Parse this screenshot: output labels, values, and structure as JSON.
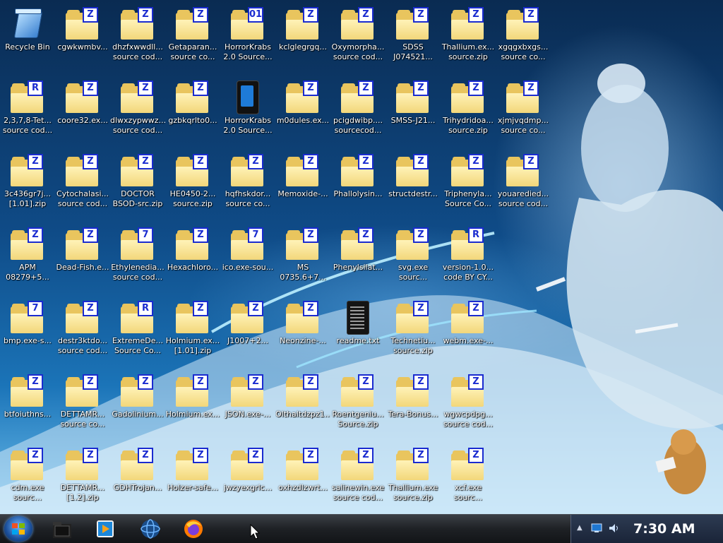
{
  "desktop": {
    "icons": [
      {
        "label": "Recycle Bin",
        "type": "recycle"
      },
      {
        "label": "cgwkwmbv...",
        "type": "zip",
        "badge": "Z"
      },
      {
        "label": "dhzfxwwdll... source cod...",
        "type": "zip",
        "badge": "Z"
      },
      {
        "label": "Getaparan... source co...",
        "type": "zip",
        "badge": "Z"
      },
      {
        "label": "HorrorKrabs 2.0 Source...",
        "type": "zip",
        "badge": "01"
      },
      {
        "label": "kclglegrgq...",
        "type": "zip",
        "badge": "Z"
      },
      {
        "label": "Oxymorpha... source cod...",
        "type": "zip",
        "badge": "Z"
      },
      {
        "label": "SDSS J074521...",
        "type": "zip",
        "badge": "Z"
      },
      {
        "label": "Thallium.ex... source.zip",
        "type": "zip",
        "badge": "Z"
      },
      {
        "label": "xgqgxbxgs... source co...",
        "type": "zip",
        "badge": "Z"
      },
      {
        "label": "2,3,7,8-Tet... source cod...",
        "type": "zip",
        "badge": "R"
      },
      {
        "label": "coore32.ex...",
        "type": "zip",
        "badge": "Z"
      },
      {
        "label": "dlwxzypwwz... source cod...",
        "type": "zip",
        "badge": "Z"
      },
      {
        "label": "gzbkqrlto0...",
        "type": "zip",
        "badge": "Z"
      },
      {
        "label": "HorrorKrabs 2.0 Source...",
        "type": "app"
      },
      {
        "label": "m0dules.ex...",
        "type": "zip",
        "badge": "Z"
      },
      {
        "label": "pcigdwibp.... sourcecod...",
        "type": "zip",
        "badge": "Z"
      },
      {
        "label": "SMSS-J21...",
        "type": "zip",
        "badge": "Z"
      },
      {
        "label": "Trihydridoa... source.zip",
        "type": "zip",
        "badge": "Z"
      },
      {
        "label": "xjmjvqdmp... source co...",
        "type": "zip",
        "badge": "Z"
      },
      {
        "label": "3c436gr7j... [1.01].zip",
        "type": "zip",
        "badge": "Z"
      },
      {
        "label": "Cytochalasi... source cod...",
        "type": "zip",
        "badge": "Z"
      },
      {
        "label": "DOCTOR BSOD-src.zip",
        "type": "zip",
        "badge": "Z"
      },
      {
        "label": "HE0450-2... source.zip",
        "type": "zip",
        "badge": "Z"
      },
      {
        "label": "hqfhskdor... source co...",
        "type": "zip",
        "badge": "Z"
      },
      {
        "label": "Memoxide-...",
        "type": "zip",
        "badge": "Z"
      },
      {
        "label": "Phallolysin...",
        "type": "zip",
        "badge": "Z"
      },
      {
        "label": "structdestr...",
        "type": "zip",
        "badge": "Z"
      },
      {
        "label": "Triphenyla... Source Co...",
        "type": "zip",
        "badge": "Z"
      },
      {
        "label": "youaredied... source cod...",
        "type": "zip",
        "badge": "Z"
      },
      {
        "label": "APM 08279+5...",
        "type": "zip",
        "badge": "Z"
      },
      {
        "label": "Dead-Fish.e...",
        "type": "zip",
        "badge": "Z"
      },
      {
        "label": "Ethylenedia... source cod...",
        "type": "zip",
        "badge": "7"
      },
      {
        "label": "Hexachloro...",
        "type": "zip",
        "badge": "Z"
      },
      {
        "label": "ico.exe-sou...",
        "type": "zip",
        "badge": "7"
      },
      {
        "label": "MS 0735.6+7...",
        "type": "zip",
        "badge": "Z"
      },
      {
        "label": "Phenylsilat...",
        "type": "zip",
        "badge": "Z"
      },
      {
        "label": "svg.exe sourc...",
        "type": "zip",
        "badge": "Z"
      },
      {
        "label": "version-1.0... code BY CY...",
        "type": "zip",
        "badge": "R"
      },
      {
        "label": "bmp.exe-s...",
        "type": "zip",
        "badge": "7"
      },
      {
        "label": "destr3ktdo... source cod...",
        "type": "zip",
        "badge": "Z"
      },
      {
        "label": "ExtremeDe... Source Co...",
        "type": "zip",
        "badge": "R"
      },
      {
        "label": "Holmium.ex... [1.01].zip",
        "type": "zip",
        "badge": "Z"
      },
      {
        "label": "J1007+2...",
        "type": "zip",
        "badge": "Z"
      },
      {
        "label": "Neonzine-...",
        "type": "zip",
        "badge": "Z"
      },
      {
        "label": "readme.txt",
        "type": "txt"
      },
      {
        "label": "Technetiu... source.zip",
        "type": "zip",
        "badge": "Z"
      },
      {
        "label": "webm.exe-...",
        "type": "zip",
        "badge": "Z"
      },
      {
        "label": "btfoiuthns...",
        "type": "zip",
        "badge": "Z"
      },
      {
        "label": "DETTAMR... source co...",
        "type": "zip",
        "badge": "Z"
      },
      {
        "label": "Gadolinium...",
        "type": "zip",
        "badge": "Z"
      },
      {
        "label": "Holmium.ex...",
        "type": "zip",
        "badge": "Z"
      },
      {
        "label": "JSON.exe-...",
        "type": "zip",
        "badge": "Z"
      },
      {
        "label": "Olthaltdzpz1...",
        "type": "zip",
        "badge": "Z"
      },
      {
        "label": "Roentgeniu... Source.zip",
        "type": "zip",
        "badge": "Z"
      },
      {
        "label": "Tera-Bonus...",
        "type": "zip",
        "badge": "Z"
      },
      {
        "label": "wgwcpdpg... source cod...",
        "type": "zip",
        "badge": "Z"
      },
      {
        "label": "cdm.exe sourc...",
        "type": "zip",
        "badge": "Z"
      },
      {
        "label": "DETTAMR... [1.2].zip",
        "type": "zip",
        "badge": "Z"
      },
      {
        "label": "GDHTrojan...",
        "type": "zip",
        "badge": "Z"
      },
      {
        "label": "Holzer-safe...",
        "type": "zip",
        "badge": "Z"
      },
      {
        "label": "jwzyexgrlc...",
        "type": "zip",
        "badge": "Z"
      },
      {
        "label": "oxhzdlzwrt...",
        "type": "zip",
        "badge": "Z"
      },
      {
        "label": "salinewin.exe source cod...",
        "type": "zip",
        "badge": "Z"
      },
      {
        "label": "Thallium.exe source.zip",
        "type": "zip",
        "badge": "Z"
      },
      {
        "label": "xcf.exe sourc...",
        "type": "zip",
        "badge": "Z"
      }
    ]
  },
  "taskbar": {
    "clock": "7:30 AM",
    "pinned": [
      "folder-app-icon",
      "media-player-icon",
      "globe-icon",
      "firefox-icon"
    ]
  },
  "colors": {
    "badge_blue": "#1a2bd0",
    "folder_yellow": "#e9c55e"
  }
}
